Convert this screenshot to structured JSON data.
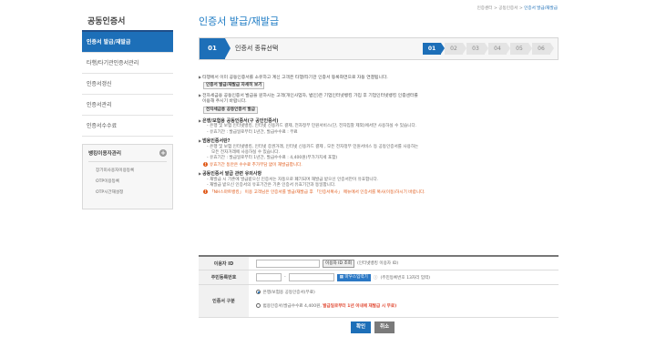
{
  "sidebar": {
    "title": "공동인증서",
    "items": [
      {
        "label": "인증서 발급/재발급"
      },
      {
        "label": "타행/타기관인증서관리"
      },
      {
        "label": "인증서갱신"
      },
      {
        "label": "인증서관리"
      },
      {
        "label": "인증서수수료"
      }
    ],
    "sub_panel": {
      "title": "뱅킹이용자관리",
      "links": [
        "장기미사용자이용등록",
        "OTP이용등록",
        "OTP시간재설정"
      ]
    }
  },
  "breadcrumb": {
    "home": "인증센터",
    "level1": "공동인증서",
    "current": "인증서 발급/재발급"
  },
  "page": {
    "title": "인증서 발급/재발급"
  },
  "stepbar": {
    "number": "01",
    "label": "인증서 종류선택",
    "steps": [
      "01",
      "02",
      "03",
      "04",
      "05",
      "06"
    ],
    "active_step": "01"
  },
  "content": {
    "intro1": "타행에서 이미 공동인증서를 소유하고 계신 고객은 타행/타기관 인증서 등록화면으로 자동 연결됩니다.",
    "btn_detail": "인증서 발급/재발급 자세히 보기",
    "intro2a": "전자세금용 공동인증서 발급을 원하시는 고객(개인사업자, 법인)은 기업인터넷뱅킹 가입 후 기업인터넷뱅킹 인증센터를",
    "intro2b": "이용해 주시기 바랍니다.",
    "btn_tax": "전자세금용 공동인증서 발급",
    "sec1_title": "은행/보험용 공동인증서(구 공인인증서)",
    "sec1_b1": "- 은행 및 보험 인터넷뱅킹, 인터넷 신용카드 결제, 전자정부 민원서비스(단, 전자입찰 제외)에서만 사용하실 수 있습니다.",
    "sec1_b2": "- 유효기간 : 발급일로부터 1년간, 발급수수료 : 무료",
    "sec2_title": "범용인증서란?",
    "sec2_b1": "- 은행 및 보험 인터넷뱅킹, 인터넷 증권거래, 인터넷 신용카드 결제 , 모든 전자정부 민원서비스 등 공동인증서를 사용하는",
    "sec2_b1b": "모든 전자거래에 사용하실 수 있습니다.",
    "sec2_b2": "- 유효기간 : 발급일로부터 1년간, 발급수수료 : 4,400원(부가가치세 포함)",
    "sec2_warn": "유효기간 동안은 수수료 추가부담 없이 재발급합니다.",
    "sec3_title": "공동인증서 발급 관련 유의사항",
    "sec3_b1": "- 재발급 시 기존에 발급받으신 인증서는 자동으로 폐기되며 재발급 받으신 인증서만이 유효합니다.",
    "sec3_b2": "- 재발급 받으신 인증서의 유효기간은 기존 인증서 유효기간과 동일합니다.",
    "sec3_warn": "「NH스마트뱅킹」 이용 고객님은 인증서를 발급/재발급 후 「인증서복사」 메뉴에서 인증서를 복사(이동)하시기 바랍니다."
  },
  "form": {
    "user_id": {
      "label": "이용자 ID",
      "value": "",
      "lookup_btn": "이용자 ID 조회",
      "hint": "(인터넷뱅킹 이용자 ID)"
    },
    "rrn": {
      "label": "주민등록번호",
      "value1": "",
      "sep": "-",
      "value2": "",
      "keyboard_btn": "마우스입력기",
      "hint": "(주민등록번호 13자리 입력)"
    },
    "cert_type": {
      "label": "인증서 구분",
      "option1": "은행/보험용 공동인증서(무료)",
      "option2_prefix": "범용인증서(발급수수료 4,400원,",
      "option2_highlight": "발급일로부터 1년 이내에 재발급 시 무료)",
      "selected": "option1"
    }
  },
  "actions": {
    "confirm": "확인",
    "cancel": "취소"
  }
}
